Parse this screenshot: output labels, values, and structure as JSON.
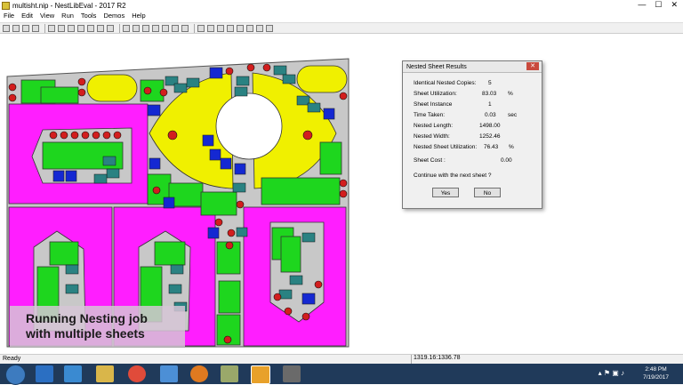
{
  "window": {
    "title": "multisht.nip - NestLibEval - 2017 R2",
    "controls": {
      "minimize": "—",
      "maximize": "☐",
      "close": "✕"
    }
  },
  "menu": [
    "File",
    "Edit",
    "View",
    "Run",
    "Tools",
    "Demos",
    "Help"
  ],
  "toolbar": {
    "button_count": 26
  },
  "dialog": {
    "title": "Nested Sheet Results",
    "close": "✕",
    "rows": [
      {
        "label": "Identical Nested Copies:",
        "value": "5",
        "unit": ""
      },
      {
        "label": "Sheet Utilization:",
        "value": "83.03",
        "unit": "%"
      },
      {
        "label": "Sheet Instance",
        "value": "1",
        "unit": ""
      },
      {
        "label": "Time Taken:",
        "value": "0.03",
        "unit": "sec"
      },
      {
        "label": "Nested Length:",
        "value": "1498.00",
        "unit": ""
      },
      {
        "label": "Nested Width:",
        "value": "1252.46",
        "unit": ""
      },
      {
        "label": "Nested Sheet Utilization:",
        "value": "76.43",
        "unit": "%"
      },
      {
        "label": "Sheet Cost :",
        "value": "0.00",
        "unit": ""
      }
    ],
    "question": "Continue with the next sheet  ?",
    "yes_label": "Yes",
    "no_label": "No"
  },
  "caption": {
    "line1": "Running Nesting job",
    "line2": "with multiple sheets"
  },
  "status": {
    "ready": "Ready",
    "coords": "1319.16:1336.78"
  },
  "taskbar": {
    "time": "2:48 PM",
    "date": "7/19/2017",
    "tray": "▴  ⚑  ▣  ♪"
  },
  "colors": {
    "sheet": "#c8c8c8",
    "magenta_part": "#ff1eff",
    "green_part": "#1ed61e",
    "yellow_part": "#f0f000",
    "blue_part": "#1428d2",
    "red_circle": "#d21e1e",
    "teal_part": "#2a8282"
  }
}
